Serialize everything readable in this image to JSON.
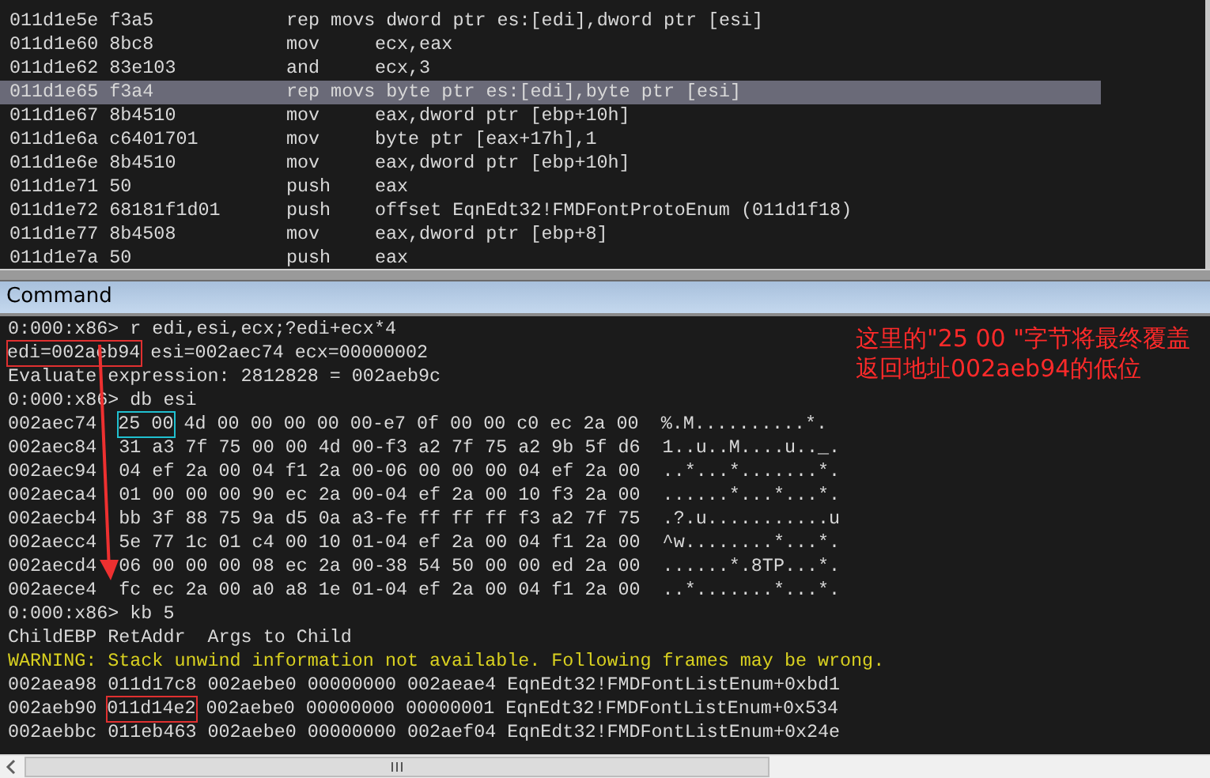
{
  "disassembly": [
    {
      "address": "011d1e5e",
      "bytes": "f3a5",
      "mnemonic": "rep movs",
      "operands": "dword ptr es:[edi],dword ptr [esi]",
      "selected": false
    },
    {
      "address": "011d1e60",
      "bytes": "8bc8",
      "mnemonic": "mov",
      "operands": "ecx,eax",
      "selected": false
    },
    {
      "address": "011d1e62",
      "bytes": "83e103",
      "mnemonic": "and",
      "operands": "ecx,3",
      "selected": false
    },
    {
      "address": "011d1e65",
      "bytes": "f3a4",
      "mnemonic": "rep movs",
      "operands": "byte ptr es:[edi],byte ptr [esi]",
      "selected": true
    },
    {
      "address": "011d1e67",
      "bytes": "8b4510",
      "mnemonic": "mov",
      "operands": "eax,dword ptr [ebp+10h]",
      "selected": false
    },
    {
      "address": "011d1e6a",
      "bytes": "c6401701",
      "mnemonic": "mov",
      "operands": "byte ptr [eax+17h],1",
      "selected": false
    },
    {
      "address": "011d1e6e",
      "bytes": "8b4510",
      "mnemonic": "mov",
      "operands": "eax,dword ptr [ebp+10h]",
      "selected": false
    },
    {
      "address": "011d1e71",
      "bytes": "50",
      "mnemonic": "push",
      "operands": "eax",
      "selected": false
    },
    {
      "address": "011d1e72",
      "bytes": "68181f1d01",
      "mnemonic": "push",
      "operands": "offset EqnEdt32!FMDFontProtoEnum (011d1f18)",
      "selected": false
    },
    {
      "address": "011d1e77",
      "bytes": "8b4508",
      "mnemonic": "mov",
      "operands": "eax,dword ptr [ebp+8]",
      "selected": false
    },
    {
      "address": "011d1e7a",
      "bytes": "50",
      "mnemonic": "push",
      "operands": "eax",
      "selected": false
    }
  ],
  "command_window": {
    "title": "Command",
    "lines": [
      {
        "kind": "text",
        "parts": [
          {
            "text": "0:000:x86> r edi,esi,ecx;?edi+ecx*4"
          }
        ]
      },
      {
        "kind": "text",
        "parts": [
          {
            "text": "edi=002aeb94",
            "color": "#e03030"
          },
          {
            "text": " esi=002aec74 ecx=00000002"
          }
        ]
      },
      {
        "kind": "text",
        "parts": [
          {
            "text": "Evaluate expression: 2812828 = 002aeb9c"
          }
        ]
      },
      {
        "kind": "text",
        "parts": [
          {
            "text": "0:000:x86> db esi"
          }
        ]
      },
      {
        "kind": "text",
        "parts": [
          {
            "text": "002aec74  "
          },
          {
            "text": "25 00",
            "color": "#20c0d0"
          },
          {
            "text": " 4d 00 00 00 00 00-e7 0f 00 00 c0 ec 2a 00  %.M..........*."
          }
        ]
      },
      {
        "kind": "text",
        "parts": [
          {
            "text": "002aec84  31 a3 7f 75 00 00 4d 00-f3 a2 7f 75 a2 9b 5f d6  1..u..M....u.._."
          }
        ]
      },
      {
        "kind": "text",
        "parts": [
          {
            "text": "002aec94  04 ef 2a 00 04 f1 2a 00-06 00 00 00 04 ef 2a 00  ..*...*.......*."
          }
        ]
      },
      {
        "kind": "text",
        "parts": [
          {
            "text": "002aeca4  01 00 00 00 90 ec 2a 00-04 ef 2a 00 10 f3 2a 00  ......*...*...*."
          }
        ]
      },
      {
        "kind": "text",
        "parts": [
          {
            "text": "002aecb4  bb 3f 88 75 9a d5 0a a3-fe ff ff ff f3 a2 7f 75  .?.u...........u"
          }
        ]
      },
      {
        "kind": "text",
        "parts": [
          {
            "text": "002aecc4  5e 77 1c 01 c4 00 10 01-04 ef 2a 00 04 f1 2a 00  ^w........*...*."
          }
        ]
      },
      {
        "kind": "text",
        "parts": [
          {
            "text": "002aecd4  06 00 00 00 08 ec 2a 00-38 54 50 00 00 ed 2a 00  ......*.8TP...*."
          }
        ]
      },
      {
        "kind": "text",
        "parts": [
          {
            "text": "002aece4  fc ec 2a 00 a0 a8 1e 01-04 ef 2a 00 04 f1 2a 00  ..*.......*...*."
          }
        ]
      },
      {
        "kind": "text",
        "parts": [
          {
            "text": "0:000:x86> kb 5"
          }
        ]
      },
      {
        "kind": "text",
        "parts": [
          {
            "text": "ChildEBP RetAddr  Args to Child"
          }
        ]
      },
      {
        "kind": "warning",
        "parts": [
          {
            "text": "WARNING: Stack unwind information not available. Following frames may be wrong."
          }
        ]
      },
      {
        "kind": "text",
        "parts": [
          {
            "text": "002aea98 011d17c8 002aebe0 00000000 002aeae4 EqnEdt32!FMDFontListEnum+0xbd1"
          }
        ]
      },
      {
        "kind": "text",
        "parts": [
          {
            "text": "002aeb90 "
          },
          {
            "text": "011d14e2",
            "color": "#e03030"
          },
          {
            "text": " 002aebe0 00000000 00000001 EqnEdt32!FMDFontListEnum+0x534"
          }
        ]
      },
      {
        "kind": "text",
        "parts": [
          {
            "text": "002aebbc 011eb463 002aebe0 00000000 002aef04 EqnEdt32!FMDFontListEnum+0x24e"
          }
        ]
      }
    ],
    "annotation": "这里的\"25 00 \"字节将最终覆盖返回地址002aeb94的低位"
  }
}
